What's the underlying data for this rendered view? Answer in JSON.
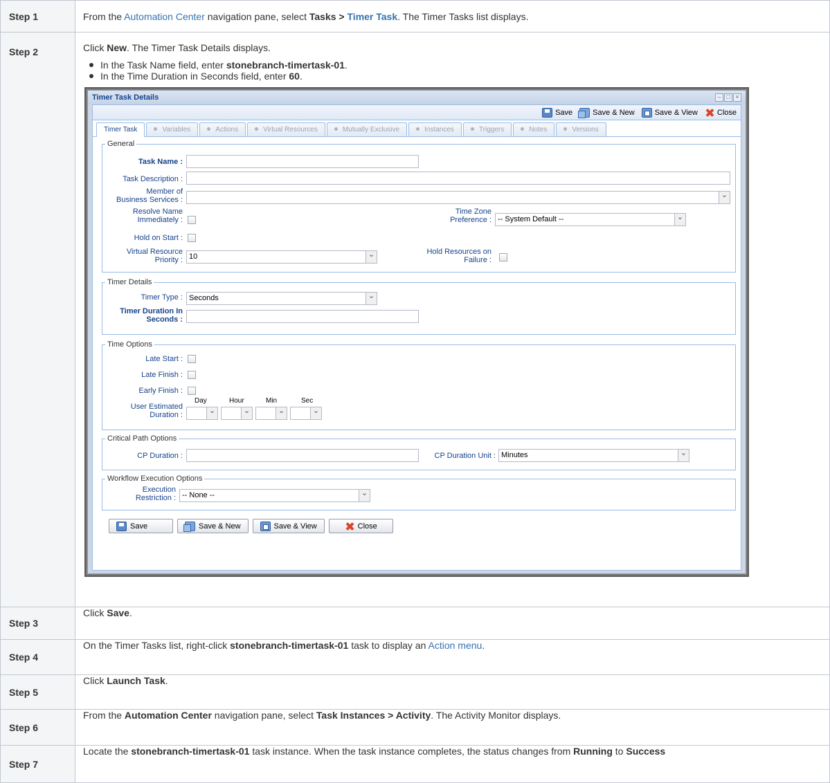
{
  "steps": [
    {
      "label": "Step 1"
    },
    {
      "label": "Step 2"
    },
    {
      "label": "Step 3"
    },
    {
      "label": "Step 4"
    },
    {
      "label": "Step 5"
    },
    {
      "label": "Step 6"
    },
    {
      "label": "Step 7"
    }
  ],
  "step1": {
    "t1": "From the ",
    "link1": "Automation Center",
    "t2": " navigation pane, select ",
    "b1": "Tasks > ",
    "link2": "Timer Task",
    "t3": ". The Timer Tasks list displays."
  },
  "step2": {
    "t1": "Click ",
    "b1": "New",
    "t2": ". The Timer Task Details displays.",
    "bullet1": {
      "t1": "In the Task Name field, enter ",
      "b1": "stonebranch-timertask-01",
      "t2": "."
    },
    "bullet2": {
      "t1": "In the Time Duration in Seconds field, enter ",
      "b1": "60",
      "t2": "."
    }
  },
  "step3": {
    "t1": "Click ",
    "b1": "Save",
    "t2": "."
  },
  "step4": {
    "t1": "On the Timer Tasks list, right-click ",
    "b1": "stonebranch-timertask-01",
    "t2": " task to display an ",
    "link1": "Action menu",
    "t3": "."
  },
  "step5": {
    "t1": "Click ",
    "b1": "Launch Task",
    "t2": "."
  },
  "step6": {
    "t1": "From the ",
    "b1": "Automation Center",
    "t2": " navigation pane, select ",
    "b2": "Task Instances > Activity",
    "t3": ". The Activity Monitor displays."
  },
  "step7": {
    "t1": "Locate the ",
    "b1": "stonebranch-timertask-01",
    "t2": " task instance. When the task instance completes, the status changes from ",
    "b2": "Running",
    "t3": " to ",
    "b3": "Success"
  },
  "window": {
    "title": "Timer Task Details",
    "toolbar": {
      "save": "Save",
      "save_new": "Save & New",
      "save_view": "Save & View",
      "close": "Close"
    },
    "tabs": [
      "Timer Task",
      "Variables",
      "Actions",
      "Virtual Resources",
      "Mutually Exclusive",
      "Instances",
      "Triggers",
      "Notes",
      "Versions"
    ],
    "general": {
      "legend": "General",
      "task_name": "Task Name :",
      "task_description": "Task Description :",
      "member_of": "Member of",
      "business_services": "Business Services :",
      "resolve": "Resolve Name",
      "immediately": "Immediately :",
      "time_zone": "Time Zone",
      "preference": "Preference :",
      "tz_value": "-- System Default --",
      "hold": "Hold on Start :",
      "vr": "Virtual Resource",
      "priority": "Priority :",
      "priority_value": "10",
      "hold_res": "Hold Resources on",
      "failure": "Failure :"
    },
    "timer": {
      "legend": "Timer Details",
      "timer_type": "Timer Type :",
      "timer_type_value": "Seconds",
      "duration": "Timer Duration In",
      "seconds": "Seconds :"
    },
    "time_options": {
      "legend": "Time Options",
      "late_start": "Late Start :",
      "late_finish": "Late Finish :",
      "early_finish": "Early Finish :",
      "user_est": "User Estimated",
      "duration": "Duration :",
      "day": "Day",
      "hour": "Hour",
      "min": "Min",
      "sec": "Sec"
    },
    "cp": {
      "legend": "Critical Path Options",
      "cp_duration": "CP Duration :",
      "cp_unit": "CP Duration Unit :",
      "cp_unit_value": "Minutes"
    },
    "wf": {
      "legend": "Workflow Execution Options",
      "execution": "Execution",
      "restriction": "Restriction :",
      "restriction_value": "-- None --"
    },
    "buttons": {
      "save": "Save",
      "save_new": "Save & New",
      "save_view": "Save & View",
      "close": "Close"
    }
  }
}
